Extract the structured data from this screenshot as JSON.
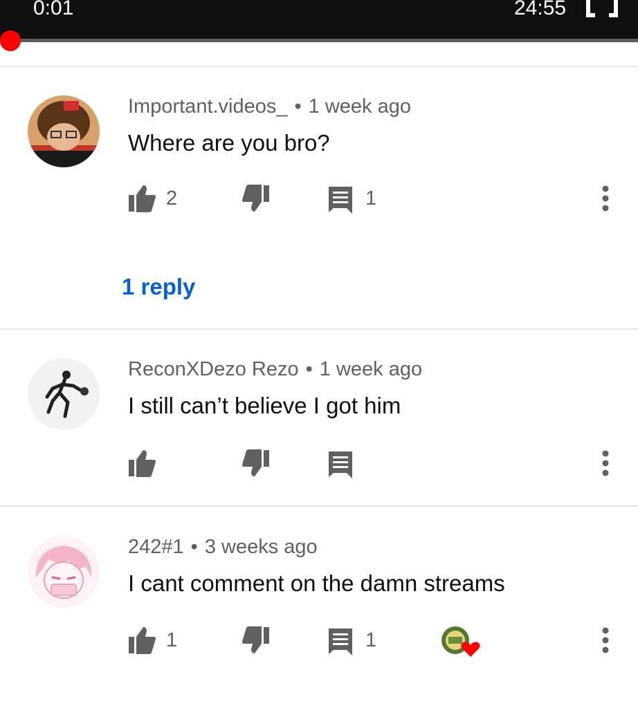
{
  "player": {
    "current_time": "0:01",
    "total_time": "24:55",
    "progress_fraction": 0.0007,
    "accent_color": "#ff0000",
    "fullscreen_icon": "fullscreen-icon"
  },
  "comments": [
    {
      "author": "Important.videos_",
      "separator": "•",
      "age": "1 week ago",
      "text": "Where are you bro?",
      "likes": "2",
      "replies_count": "1",
      "replies_link": "1 reply",
      "avatar_icon": "face-photo-avatar"
    },
    {
      "author": "ReconXDezo Rezo",
      "separator": "•",
      "age": "1 week ago",
      "text": "I still can’t believe I got him",
      "likes": "",
      "replies_count": "",
      "avatar_icon": "basketball-player-avatar"
    },
    {
      "author": "242#1",
      "separator": "•",
      "age": "3 weeks ago",
      "text": "I cant comment on the damn streams",
      "likes": "1",
      "replies_count": "1",
      "avatar_icon": "anime-girl-avatar",
      "creator_heart": true
    }
  ],
  "icons": {
    "like": "thumb-up-icon",
    "dislike": "thumb-down-icon",
    "reply": "comment-icon",
    "more": "more-vert-icon",
    "heart": "creator-heart-icon"
  },
  "colors": {
    "link": "#065fd4",
    "meta_text": "#606060",
    "icon": "#606060",
    "heart": "#ff0000"
  }
}
